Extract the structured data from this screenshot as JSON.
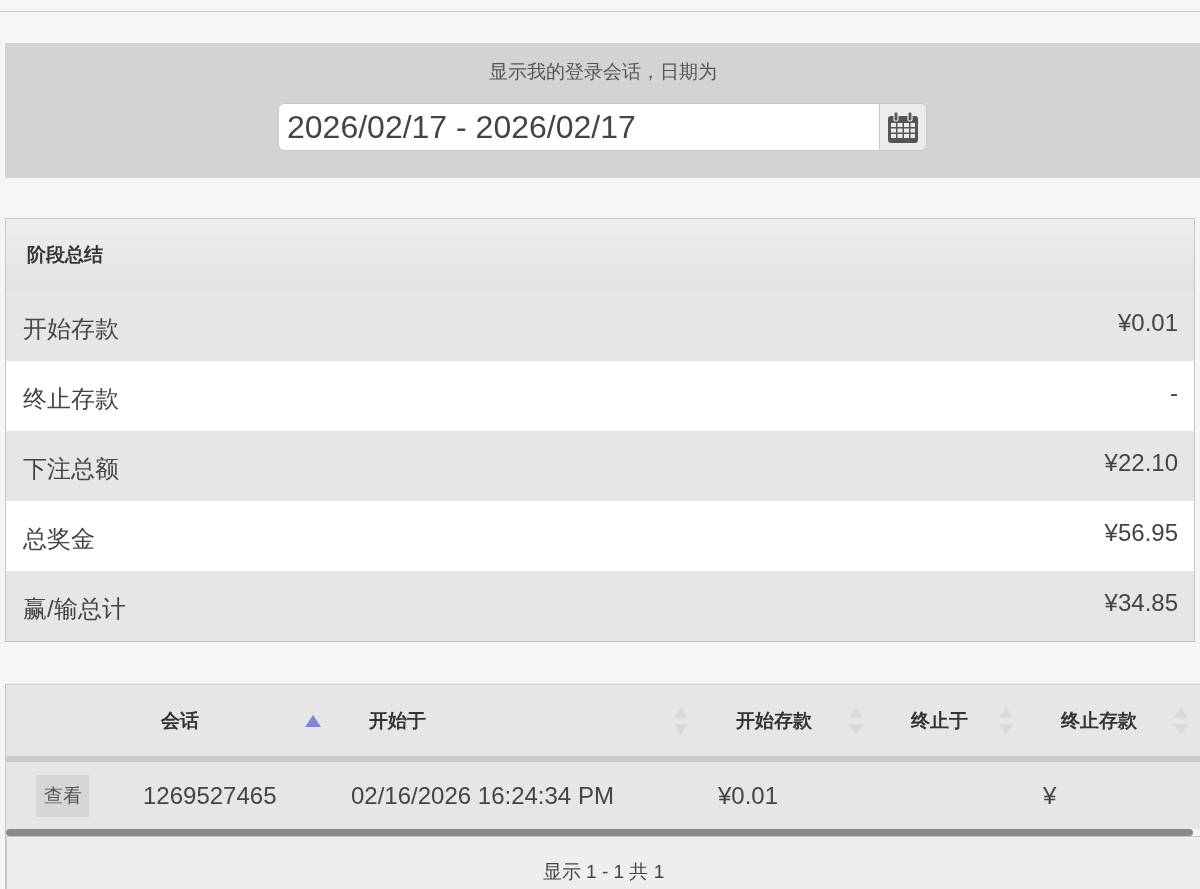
{
  "date_filter": {
    "label": "显示我的登录会话，日期为",
    "value": "2026/02/17 - 2026/02/17"
  },
  "summary": {
    "title": "阶段总结",
    "rows": [
      {
        "label": "开始存款",
        "value": "¥0.01"
      },
      {
        "label": "终止存款",
        "value": "-"
      },
      {
        "label": "下注总额",
        "value": "¥22.10"
      },
      {
        "label": "总奖金",
        "value": "¥56.95"
      },
      {
        "label": "赢/输总计",
        "value": "¥34.85"
      }
    ]
  },
  "sessions_table": {
    "columns": [
      {
        "label": "会话",
        "sorted": true
      },
      {
        "label": "开始于",
        "sorted": false
      },
      {
        "label": "开始存款",
        "sorted": false
      },
      {
        "label": "终止于",
        "sorted": false
      },
      {
        "label": "终止存款",
        "sorted": false
      }
    ],
    "rows": [
      {
        "action": "查看",
        "session": "1269527465",
        "started_at": "02/16/2026 16:24:34 PM",
        "start_deposit": "¥0.01",
        "end_deposit": "¥"
      }
    ],
    "info": "显示 1 - 1 共 1"
  }
}
